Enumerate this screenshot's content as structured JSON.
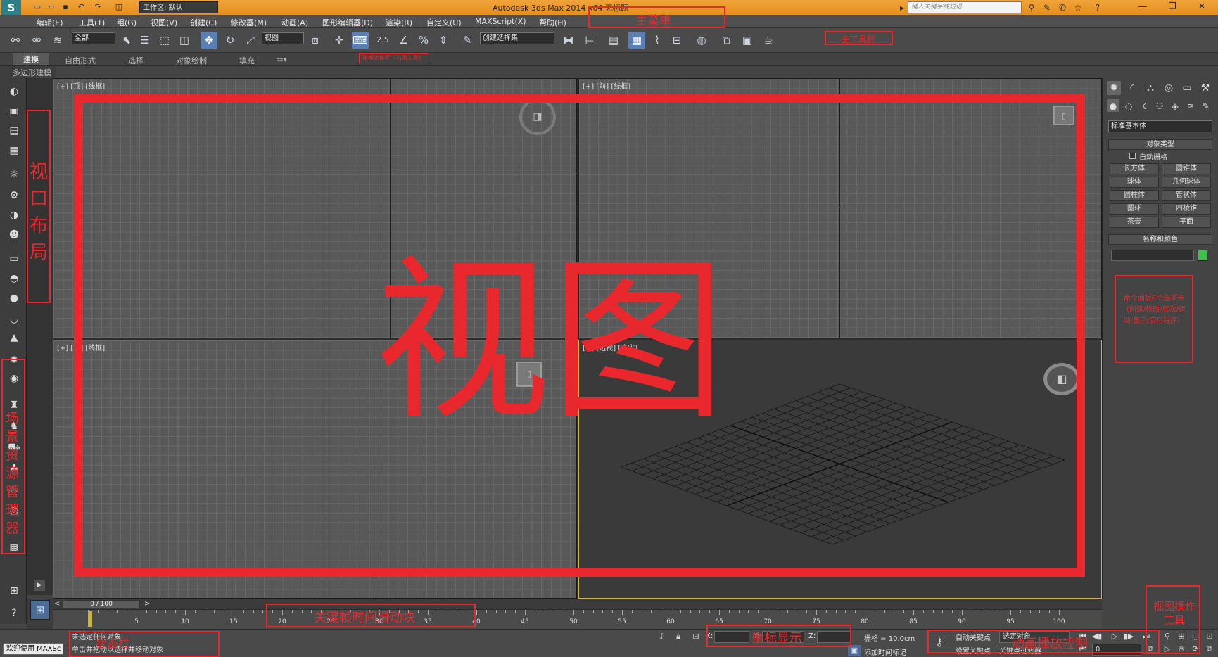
{
  "titlebar": {
    "logo": "S",
    "workspace": "工作区: 默认",
    "app_title": "Autodesk 3ds Max  2014 x64    无标题",
    "search_placeholder": "键入关键字或短语"
  },
  "menu": [
    "编辑(E)",
    "工具(T)",
    "组(G)",
    "视图(V)",
    "创建(C)",
    "修改器(M)",
    "动画(A)",
    "图形编辑器(D)",
    "渲染(R)",
    "自定义(U)",
    "MAXScript(X)",
    "帮助(H)"
  ],
  "toolbar": {
    "selection_filter": "全部",
    "ref_coord": "视图",
    "snap_angle": "2.5",
    "named_selection": "创建选择集"
  },
  "ribbon": {
    "tabs": [
      "建模",
      "自由形式",
      "选择",
      "对象绘制",
      "填充"
    ],
    "sub": "多边形建模"
  },
  "viewports": {
    "top_left": "[+] [顶] [线框]",
    "top_right": "[+] [前] [线框]",
    "bottom_left": "[+] [左] [线框]",
    "bottom_right": "[+] [透视] [真实]"
  },
  "command_panel": {
    "dropdown": "标准基本体",
    "object_type_header": "对象类型",
    "autogrid": "自动栅格",
    "buttons": [
      "长方体",
      "圆锥体",
      "球体",
      "几何球体",
      "圆柱体",
      "管状体",
      "圆环",
      "四棱锥",
      "茶壶",
      "平面"
    ],
    "name_color_header": "名称和颜色",
    "object_color": "#3fc04a"
  },
  "timeline": {
    "frame_display": "0 / 100",
    "ticks": [
      "5",
      "10",
      "15",
      "20",
      "25",
      "30",
      "35",
      "40",
      "45",
      "50",
      "55",
      "60",
      "65",
      "70",
      "75",
      "80",
      "85",
      "90",
      "95",
      "100"
    ]
  },
  "status": {
    "maxscript": "欢迎使用 MAXSc",
    "line1": "未选定任何对象",
    "line2": "单击并拖动以选择并移动对象",
    "x_label": "X:",
    "y_label": "Y:",
    "z_label": "Z:",
    "grid": "栅格 = 10.0cm",
    "auto_key": "自动关键点",
    "set_key": "设置关键点",
    "selected": "选定对象",
    "key_filter": "关键点过滤器...",
    "add_time_tag": "添加时间标记",
    "frame": "0"
  },
  "annotations": {
    "main_menu": "主菜单",
    "main_toolbar": "主工具栏",
    "ribbon_note": "建模功能区（石墨工具）",
    "viewport_layout": "视口布局",
    "view": "视图",
    "command_panel_note": "命令面板6个选项卡（创建/修改/层次/运动/显示/实用程序）",
    "scene_explorer": "场景资源管理器",
    "time_slider": "关键帧时间滑动块",
    "coordinates": "坐标显示",
    "anim_controls": "动画播放控制",
    "viewport_nav": "视图操作工具",
    "status_bar": "状态栏"
  },
  "colors": {
    "annotation": "#e8282c",
    "titlebar": "#e8951f",
    "persp_border": "#d6b340"
  }
}
